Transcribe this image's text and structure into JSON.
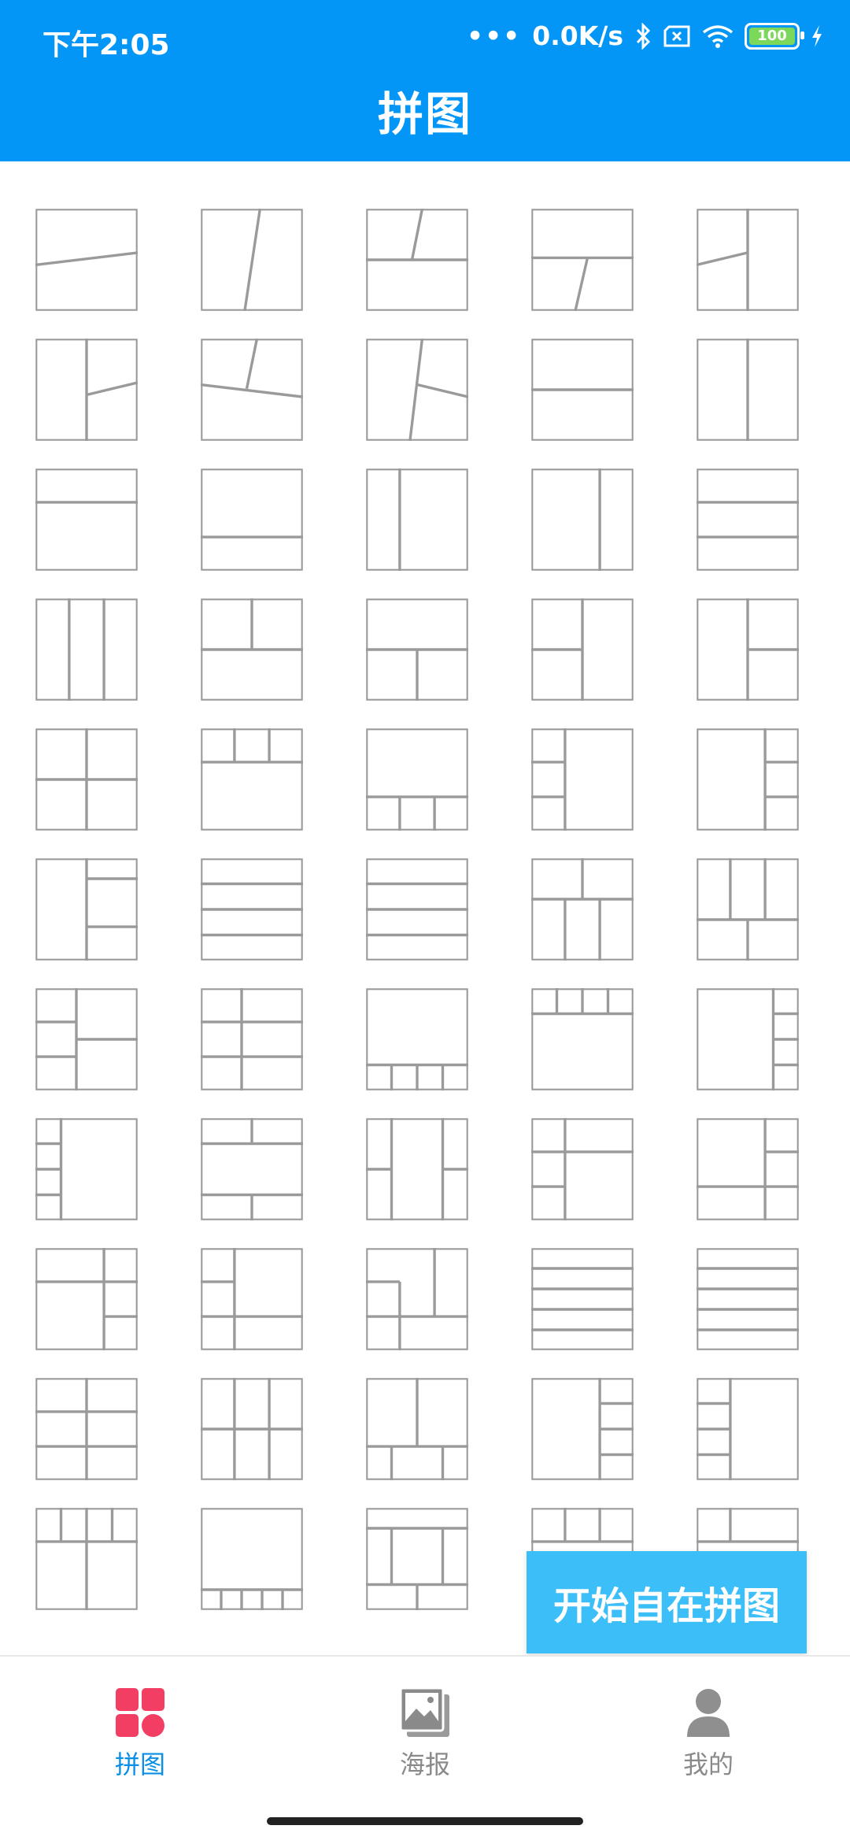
{
  "status_bar": {
    "time": "下午2:05",
    "network_speed": "0.0K/s",
    "battery": "100",
    "icons": [
      "bluetooth-icon",
      "sim-icon",
      "wifi-icon",
      "battery-icon",
      "charging-icon"
    ]
  },
  "header": {
    "title": "拼图"
  },
  "templates": {
    "count": 55,
    "label": "puzzle layout templates"
  },
  "fab": {
    "label": "开始自在拼图"
  },
  "bottom_nav": {
    "items": [
      {
        "label": "拼图",
        "icon": "puzzle-icon",
        "active": true
      },
      {
        "label": "海报",
        "icon": "poster-icon",
        "active": false
      },
      {
        "label": "我的",
        "icon": "profile-icon",
        "active": false
      }
    ]
  },
  "colors": {
    "header": "#0396F7",
    "fab": "#3CBEF8",
    "active_tab": "#0a8fe6",
    "puzzle_icon": "#F23E63",
    "template_stroke": "#9a9a9a"
  }
}
